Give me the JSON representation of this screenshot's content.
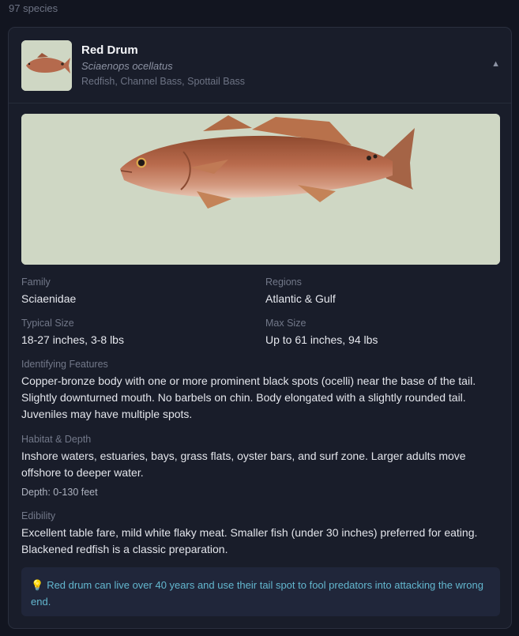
{
  "list": {
    "count_label": "97 species"
  },
  "species": {
    "name": "Red Drum",
    "scientific_name": "Sciaenops ocellatus",
    "common_names": "Redfish, Channel Bass, Spottail Bass",
    "collapse_icon": "▲",
    "facts": {
      "family_label": "Family",
      "family": "Sciaenidae",
      "regions_label": "Regions",
      "regions": "Atlantic & Gulf",
      "typical_size_label": "Typical Size",
      "typical_size": "18-27 inches, 3-8 lbs",
      "max_size_label": "Max Size",
      "max_size": "Up to 61 inches, 94 lbs"
    },
    "features_label": "Identifying Features",
    "features": "Copper-bronze body with one or more prominent black spots (ocelli) near the base of the tail. Slightly downturned mouth. No barbels on chin. Body elongated with a slightly rounded tail. Juveniles may have multiple spots.",
    "habitat_label": "Habitat & Depth",
    "habitat": "Inshore waters, estuaries, bays, grass flats, oyster bars, and surf zone. Larger adults move offshore to deeper water.",
    "depth": "Depth: 0-130 feet",
    "edibility_label": "Edibility",
    "edibility": "Excellent table fare, mild white flaky meat. Smaller fish (under 30 inches) preferred for eating. Blackened redfish is a classic preparation.",
    "tip_icon": "lightbulb-icon",
    "tip": "Red drum can live over 40 years and use their tail spot to fool predators into attacking the wrong end."
  },
  "colors": {
    "background": "#121520",
    "card": "#191d2a",
    "tip_text": "#63b7cf",
    "image_bg": "#cfd7c4"
  }
}
